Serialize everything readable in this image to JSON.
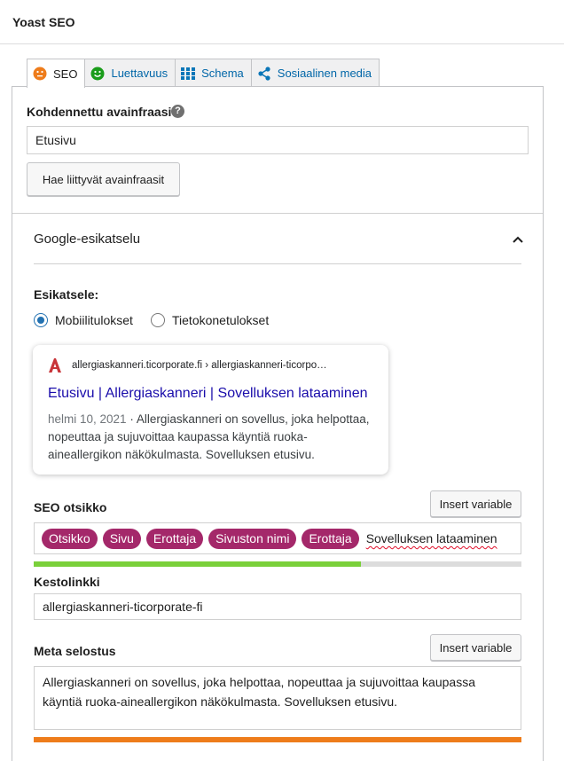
{
  "header": {
    "title": "Yoast SEO"
  },
  "tabs": [
    {
      "label": "SEO",
      "icon": "seo-score-face-icon",
      "color": "#ee7c1b"
    },
    {
      "label": "Luettavuus",
      "icon": "readability-face-icon",
      "color": "#1a9c1a"
    },
    {
      "label": "Schema",
      "icon": "schema-grid-icon",
      "color": "#0a76b8"
    },
    {
      "label": "Sosiaalinen media",
      "icon": "share-icon",
      "color": "#0a76b8"
    }
  ],
  "focus_keyphrase": {
    "label": "Kohdennettu avainfraasi",
    "help": "?",
    "value": "Etusivu",
    "related_button": "Hae liittyvät avainfraasit"
  },
  "google_preview": {
    "title": "Google-esikatselu",
    "preview_label": "Esikatsele:",
    "options": [
      {
        "label": "Mobiilitulokset",
        "selected": true
      },
      {
        "label": "Tietokonetulokset",
        "selected": false
      }
    ],
    "card": {
      "breadcrumb": "allergiaskanneri.ticorporate.fi › allergiaskanneri-ticorpo…",
      "title": "Etusivu | Allergiaskanneri | Sovelluksen lataaminen",
      "date": "helmi 10, 2021",
      "snippet": " · Allergiaskanneri on sovellus, joka helpottaa, nopeuttaa ja sujuvoittaa kaupassa käyntiä ruoka-aineallergikon näkökulmasta. Sovelluksen etusivu."
    }
  },
  "seo_title": {
    "label": "SEO otsikko",
    "insert_button": "Insert variable",
    "pills": [
      "Otsikko",
      "Sivu",
      "Erottaja",
      "Sivuston nimi",
      "Erottaja"
    ],
    "text": "Sovelluksen lataaminen",
    "progress": 0.67,
    "progress_color": "#7ad03a"
  },
  "slug": {
    "label": "Kestolinkki",
    "value": "allergiaskanneri-ticorporate-fi"
  },
  "meta_description": {
    "label": "Meta selostus",
    "insert_button": "Insert variable",
    "value": "Allergiaskanneri on sovellus, joka helpottaa, nopeuttaa ja sujuvoittaa kaupassa käyntiä ruoka-aineallergikon näkökulmasta. Sovelluksen etusivu.",
    "progress": 1.0,
    "progress_color": "#ee7c1b"
  },
  "colors": {
    "accent": "#2271b1",
    "pill": "#a4286a",
    "link": "#1a0dab",
    "favicon": "#c8353a"
  }
}
